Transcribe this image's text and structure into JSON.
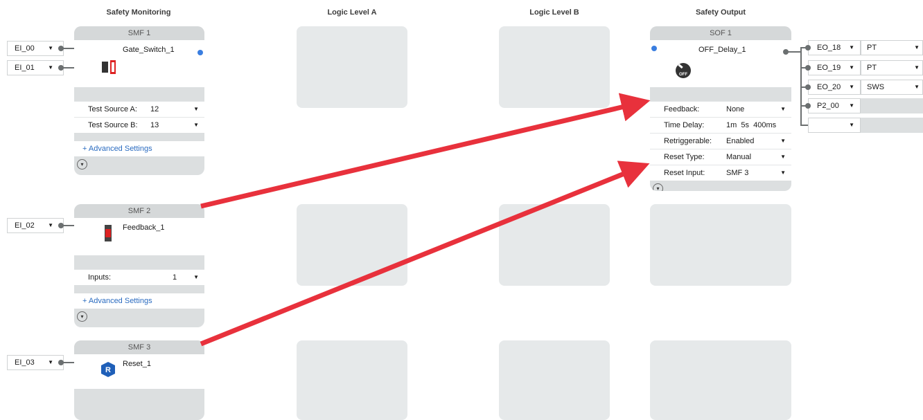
{
  "columns": {
    "safety_monitoring": "Safety Monitoring",
    "logic_a": "Logic Level A",
    "logic_b": "Logic Level B",
    "safety_output": "Safety Output"
  },
  "inputs": {
    "ei00": "EI_00",
    "ei01": "EI_01",
    "ei02": "EI_02",
    "ei03": "EI_03"
  },
  "smf1": {
    "title": "SMF 1",
    "name": "Gate_Switch_1",
    "rows": [
      {
        "label": "Test Source A:",
        "value": "12"
      },
      {
        "label": "Test Source B:",
        "value": "13"
      }
    ],
    "advanced": "+ Advanced Settings"
  },
  "smf2": {
    "title": "SMF 2",
    "name": "Feedback_1",
    "rows": [
      {
        "label": "Inputs:",
        "value": "1"
      }
    ],
    "advanced": "+ Advanced Settings"
  },
  "smf3": {
    "title": "SMF 3",
    "name": "Reset_1"
  },
  "sof1": {
    "title": "SOF 1",
    "name": "OFF_Delay_1",
    "rows": [
      {
        "label": "Feedback:",
        "value": "None"
      },
      {
        "label": "Time Delay:",
        "value": "1m  5s  400ms"
      },
      {
        "label": "Retriggerable:",
        "value": "Enabled"
      },
      {
        "label": "Reset Type:",
        "value": "Manual"
      },
      {
        "label": "Reset Input:",
        "value": "SMF 3"
      }
    ]
  },
  "outputs": [
    {
      "name": "EO_18",
      "type": "PT"
    },
    {
      "name": "EO_19",
      "type": "PT"
    },
    {
      "name": "EO_20",
      "type": "SWS"
    },
    {
      "name": "P2_00",
      "type": ""
    },
    {
      "name": "",
      "type": ""
    }
  ],
  "colors": {
    "arrow": "#e8313c",
    "accent": "#3a7ee0",
    "panel": "#dcdfe0"
  },
  "icons": {
    "gate_switch": "gate-switch-icon",
    "feedback": "feedback-icon",
    "reset": "reset-icon",
    "off_delay": "off-delay-icon",
    "chevron": "chevron-down-icon"
  }
}
